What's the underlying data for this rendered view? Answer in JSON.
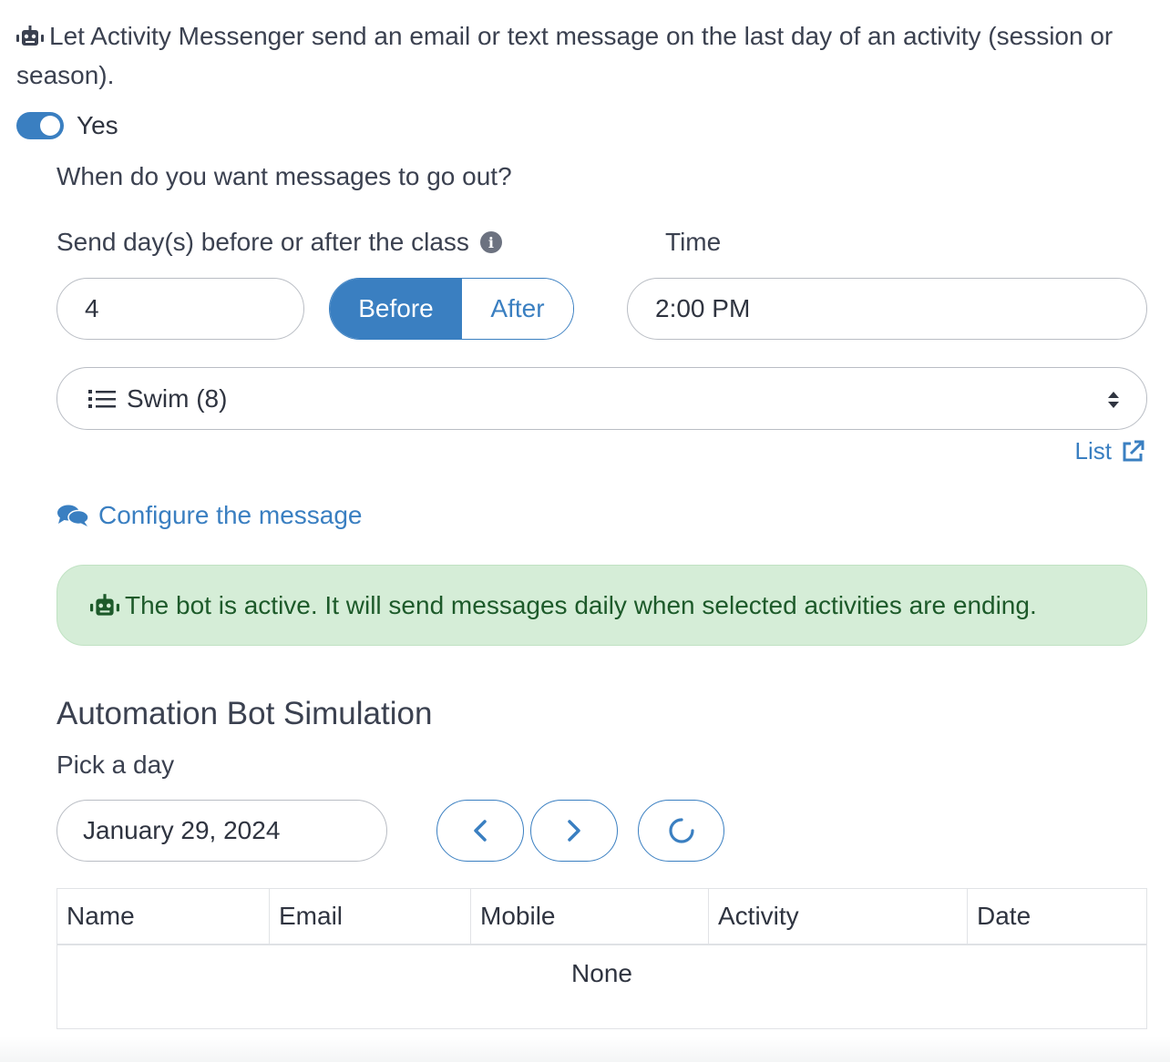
{
  "intro": {
    "text": "Let Activity Messenger send an email or text message on the last day of an activity (session or season).",
    "icon": "robot-icon"
  },
  "toggle": {
    "label": "Yes",
    "checked": true
  },
  "schedule": {
    "question": "When do you want messages to go out?",
    "days_label": "Send day(s) before or after the class",
    "days_value": "4",
    "before_label": "Before",
    "after_label": "After",
    "selected": "Before",
    "time_label": "Time",
    "time_value": "2:00 PM"
  },
  "list_select": {
    "value": "Swim (8)",
    "link_label": "List"
  },
  "configure_link": "Configure the message",
  "alert": {
    "text": "The bot is active. It will send messages daily when selected activities are ending."
  },
  "simulation": {
    "title": "Automation Bot Simulation",
    "pick_label": "Pick a day",
    "date_value": "January 29, 2024",
    "table": {
      "columns": [
        "Name",
        "Email",
        "Mobile",
        "Activity",
        "Date"
      ],
      "empty_text": "None"
    }
  },
  "colors": {
    "accent": "#3a7fc1",
    "alert_bg": "#d5edd7",
    "alert_text": "#1d5a2a"
  }
}
